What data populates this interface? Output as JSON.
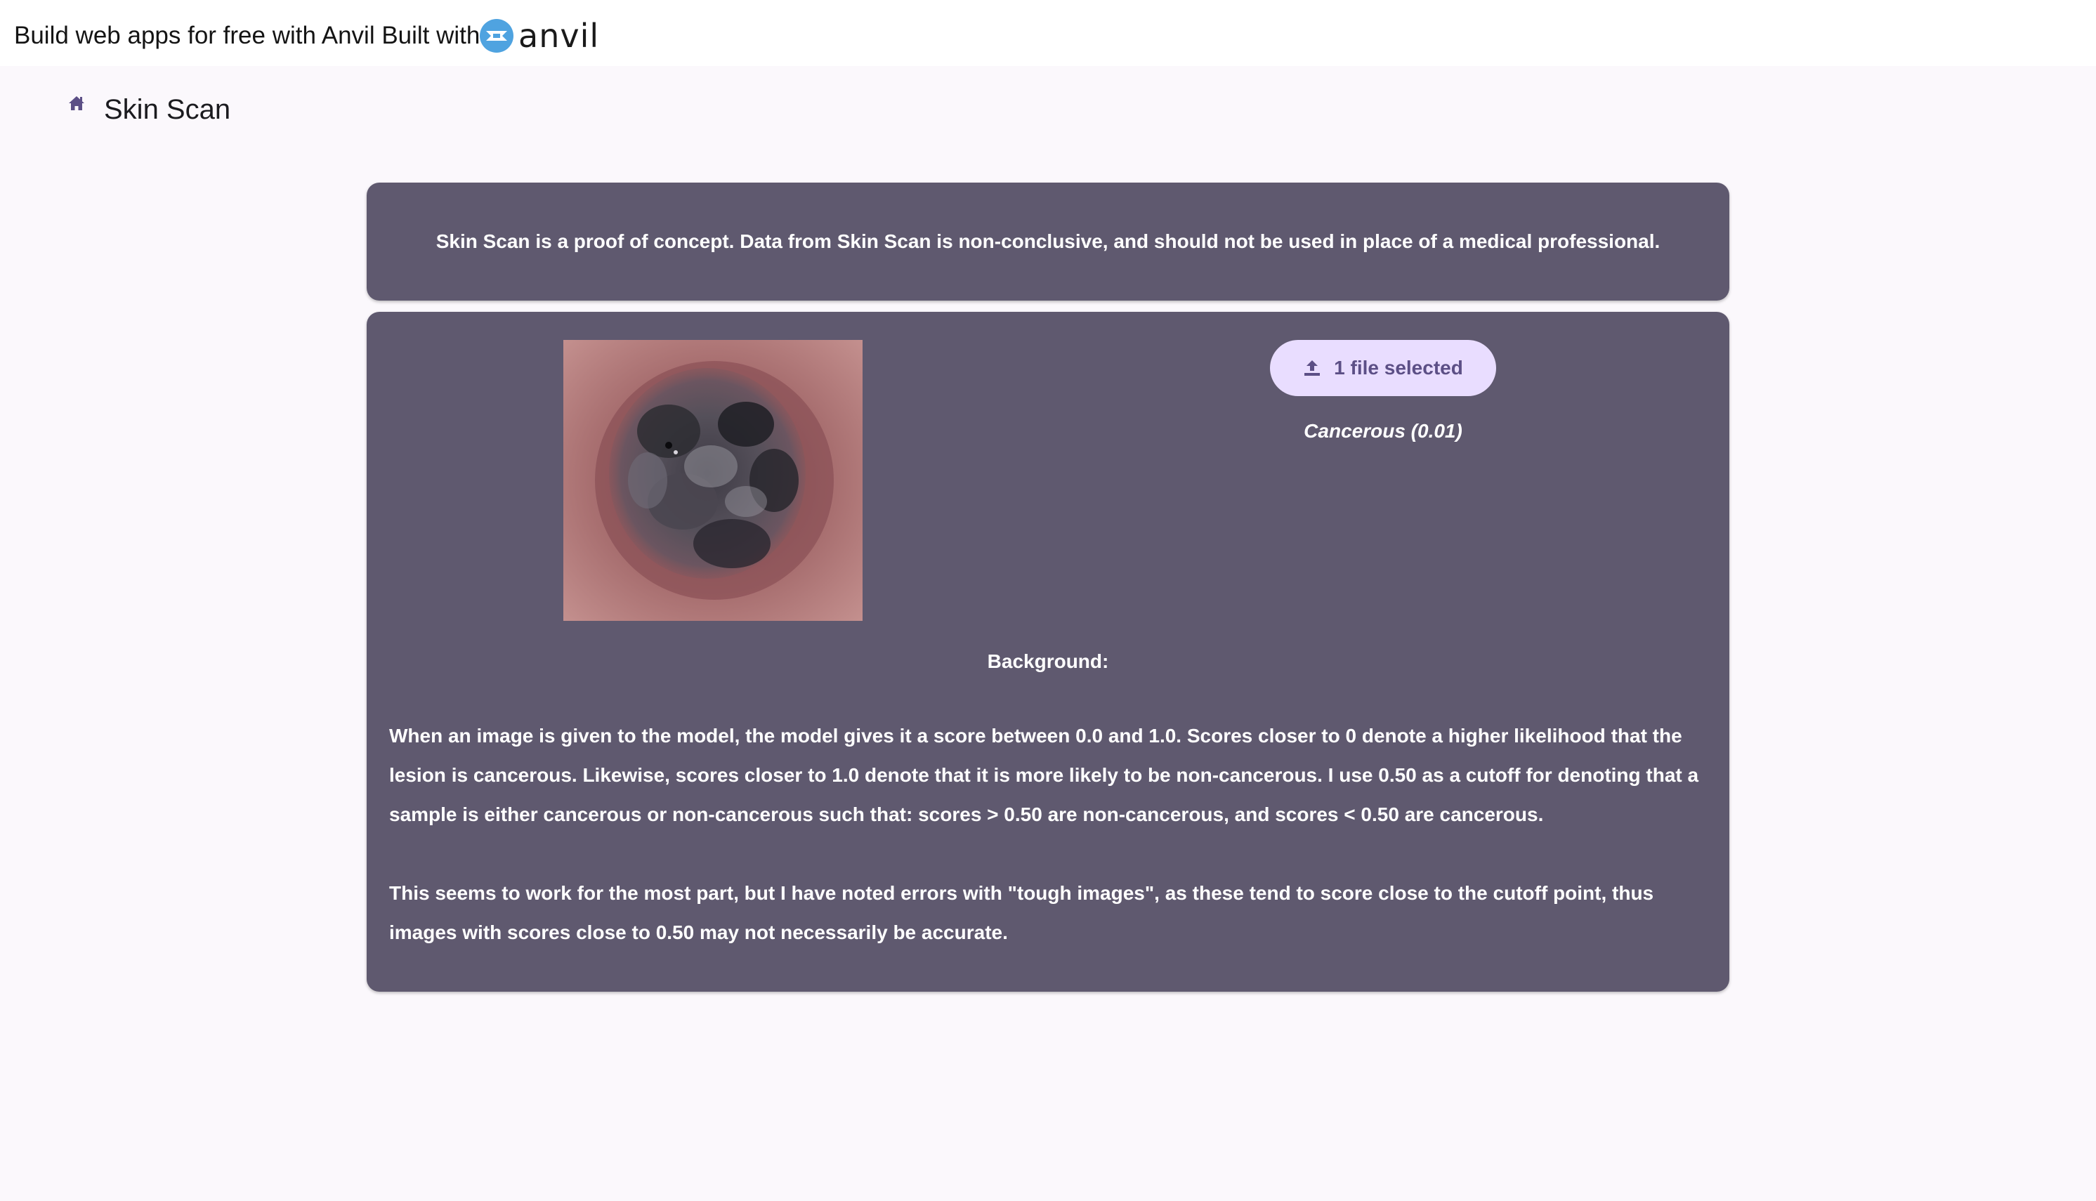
{
  "banner": {
    "text": "Build web apps for free with Anvil Built with",
    "logo_word": "anvil",
    "logo_icon": "anvil-logo-icon",
    "logo_color": "#4fa3e0"
  },
  "app": {
    "home_icon": "home-icon",
    "title": "Skin Scan"
  },
  "notice": {
    "text": "Skin Scan is a proof of concept. Data from Skin Scan is non-conclusive, and should not be used in place of a medical professional."
  },
  "main": {
    "image_alt": "skin lesion photo",
    "upload": {
      "icon": "upload-icon",
      "label": "1 file selected"
    },
    "result": "Cancerous (0.01)",
    "background_heading": "Background:",
    "paragraphs": [
      "When an image is given to the model, the model gives it a score between 0.0 and 1.0. Scores closer to 0 denote a higher likelihood that the lesion is cancerous. Likewise, scores closer to 1.0 denote that it is more likely to be non-cancerous. I use 0.50 as a cutoff for denoting that a sample is either cancerous or non-cancerous such that: scores > 0.50 are non-cancerous, and scores < 0.50 are cancerous.",
      "This seems to work for the most part, but I have noted errors with \"tough images\", as these tend to score close to the cutoff point, thus images with scores close to 0.50 may not necessarily be accurate."
    ]
  },
  "colors": {
    "page_bg": "#fbf8fc",
    "card_bg": "#5f596f",
    "button_bg": "#e9ddff",
    "button_text": "#5c4f86",
    "accent": "#5c4f86"
  }
}
